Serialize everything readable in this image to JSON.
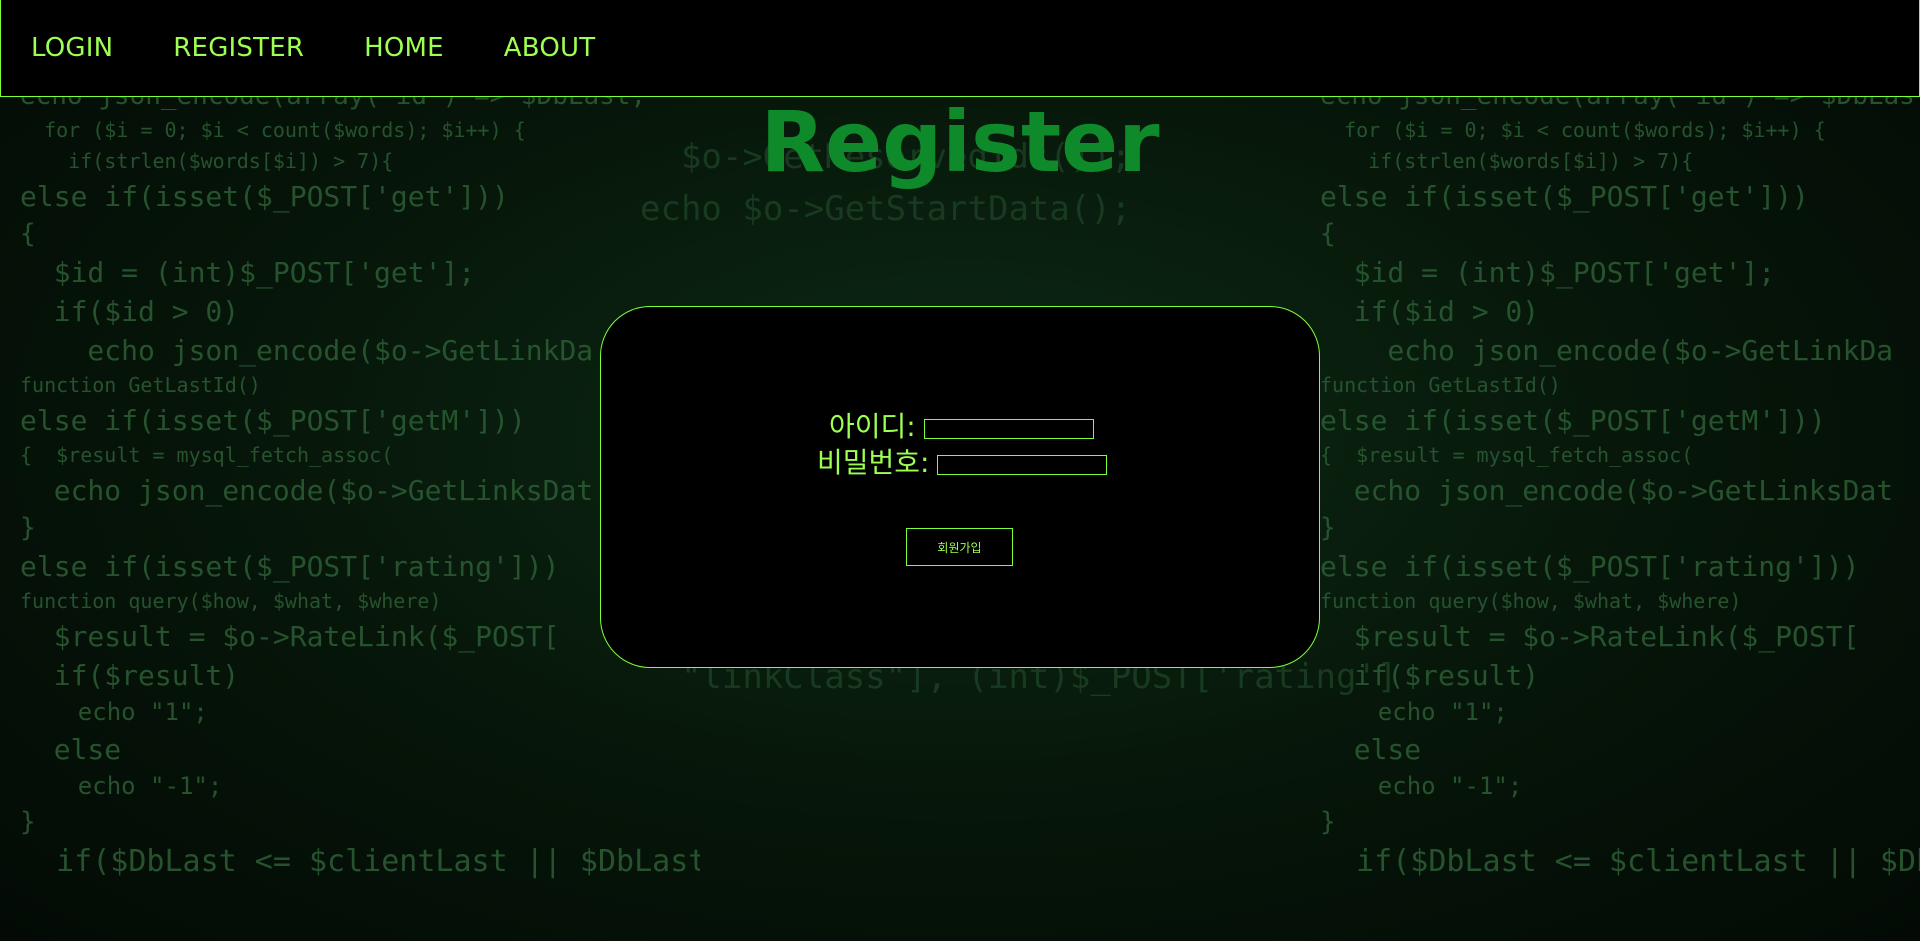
{
  "nav": {
    "items": [
      "LOGIN",
      "REGISTER",
      "HOME",
      "ABOUT"
    ]
  },
  "page": {
    "title": "Register"
  },
  "form": {
    "id_label": "아이디:",
    "password_label": "비밀번호:",
    "id_value": "",
    "password_value": "",
    "submit_label": "회원가입"
  },
  "colors": {
    "accent": "#7dff3a",
    "title": "#0f8a2a",
    "background": "#000000",
    "code_bg": "#061509"
  }
}
